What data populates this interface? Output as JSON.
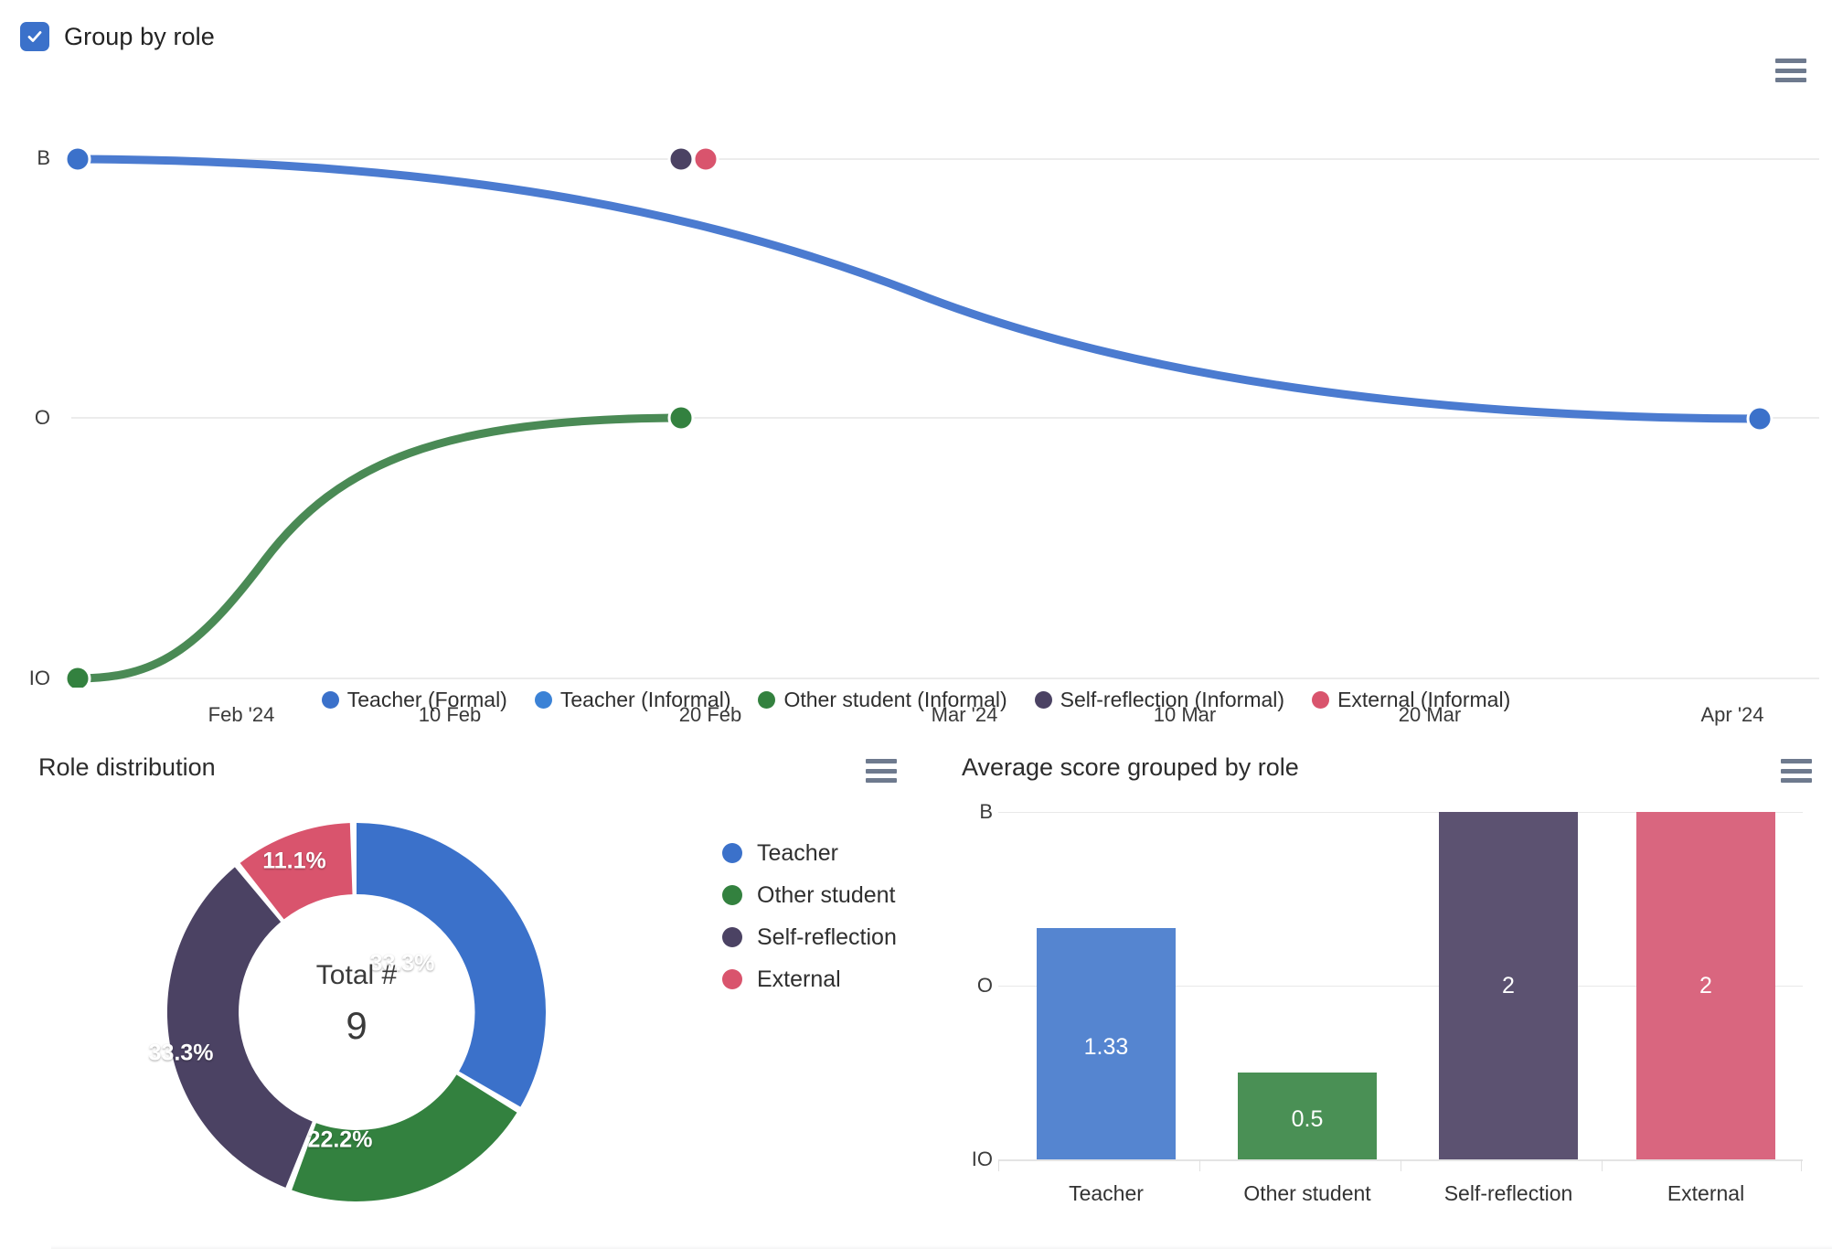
{
  "controls": {
    "group_by_role": {
      "label": "Group by role",
      "checked": true,
      "accent": "#3b71ca",
      "icon": "check-icon"
    }
  },
  "menu_icon": "hamburger-menu-icon",
  "colors": {
    "teacher_formal": "#3b71ca",
    "teacher_informal": "#3b82d6",
    "other_student": "#33813f",
    "self_reflection": "#4b4263",
    "external": "#d9546d",
    "grid": "#ececec",
    "text": "#2f2f2f"
  },
  "line_chart": {
    "menu_label": "Chart menu",
    "y_axis": {
      "ticks": [
        "B",
        "O",
        "IO"
      ],
      "values": [
        2,
        1,
        0
      ]
    },
    "x_axis": {
      "ticks": [
        "Feb '24",
        "10 Feb",
        "20 Feb",
        "Mar '24",
        "10 Mar",
        "20 Mar",
        "Apr '24"
      ]
    },
    "legend": [
      {
        "label": "Teacher (Formal)",
        "color": "#3b71ca"
      },
      {
        "label": "Teacher (Informal)",
        "color": "#3b82d6"
      },
      {
        "label": "Other student (Informal)",
        "color": "#33813f"
      },
      {
        "label": "Self-reflection (Informal)",
        "color": "#4b4263"
      },
      {
        "label": "External (Informal)",
        "color": "#d9546d"
      }
    ]
  },
  "chart_data": [
    {
      "type": "line",
      "title": "",
      "xlabel": "",
      "ylabel": "",
      "ylim": [
        0,
        2
      ],
      "y_tick_labels": [
        "IO",
        "O",
        "B"
      ],
      "y_tick_values": [
        0,
        1,
        2
      ],
      "x_tick_labels": [
        "Feb '24",
        "10 Feb",
        "20 Feb",
        "Mar '24",
        "10 Mar",
        "20 Mar",
        "Apr '24"
      ],
      "grid": true,
      "legend_position": "bottom",
      "series": [
        {
          "name": "Teacher (Formal)",
          "color": "#3b71ca",
          "points": [
            {
              "x": "Jan '24",
              "y": 2
            },
            {
              "x": "Apr '24",
              "y": 1
            }
          ]
        },
        {
          "name": "Teacher (Informal)",
          "color": "#3b82d6",
          "points": []
        },
        {
          "name": "Other student (Informal)",
          "color": "#33813f",
          "points": [
            {
              "x": "Jan '24",
              "y": 0
            },
            {
              "x": "19 Feb",
              "y": 1
            }
          ]
        },
        {
          "name": "Self-reflection (Informal)",
          "color": "#4b4263",
          "points": [
            {
              "x": "19 Feb",
              "y": 2
            }
          ]
        },
        {
          "name": "External (Informal)",
          "color": "#d9546d",
          "points": [
            {
              "x": "20 Feb",
              "y": 2
            }
          ]
        }
      ]
    },
    {
      "type": "pie",
      "title": "Role distribution",
      "center_label": "Total #",
      "center_value": "9",
      "total": 9,
      "legend_position": "right",
      "categories": [
        "Teacher",
        "Other student",
        "Self-reflection",
        "External"
      ],
      "values": [
        3,
        2,
        3,
        1
      ],
      "percent_labels": [
        "33.3%",
        "22.2%",
        "33.3%",
        "11.1%"
      ],
      "colors": [
        "#3b71ca",
        "#33813f",
        "#4b4263",
        "#d9546d"
      ]
    },
    {
      "type": "bar",
      "title": "Average score grouped by role",
      "xlabel": "",
      "ylabel": "",
      "ylim": [
        0,
        2
      ],
      "y_tick_labels": [
        "IO",
        "O",
        "B"
      ],
      "y_tick_values": [
        0,
        1,
        2
      ],
      "grid": true,
      "categories": [
        "Teacher",
        "Other student",
        "Self-reflection",
        "External"
      ],
      "values": [
        1.33,
        0.5,
        2,
        2
      ],
      "value_labels": [
        "1.33",
        "0.5",
        "2",
        "2"
      ],
      "colors": [
        "#5585d0",
        "#4a9055",
        "#5c5271",
        "#d9667f"
      ]
    }
  ],
  "role_distribution": {
    "title": "Role distribution",
    "menu_label": "Chart menu",
    "center_label": "Total #",
    "center_value": "9",
    "slices": [
      {
        "label": "Teacher",
        "percent": "33.3%",
        "color": "#3b71ca"
      },
      {
        "label": "Other student",
        "percent": "22.2%",
        "color": "#33813f"
      },
      {
        "label": "Self-reflection",
        "percent": "33.3%",
        "color": "#4b4263"
      },
      {
        "label": "External",
        "percent": "11.1%",
        "color": "#d9546d"
      }
    ]
  },
  "average_score": {
    "title": "Average score grouped by role",
    "menu_label": "Chart menu",
    "y_ticks": [
      "B",
      "O",
      "IO"
    ],
    "bars": [
      {
        "label": "Teacher",
        "value": "1.33",
        "num": 1.33,
        "color": "#5585d0"
      },
      {
        "label": "Other student",
        "value": "0.5",
        "num": 0.5,
        "color": "#4a9055"
      },
      {
        "label": "Self-reflection",
        "value": "2",
        "num": 2,
        "color": "#5c5271"
      },
      {
        "label": "External",
        "value": "2",
        "num": 2,
        "color": "#d9667f"
      }
    ]
  }
}
